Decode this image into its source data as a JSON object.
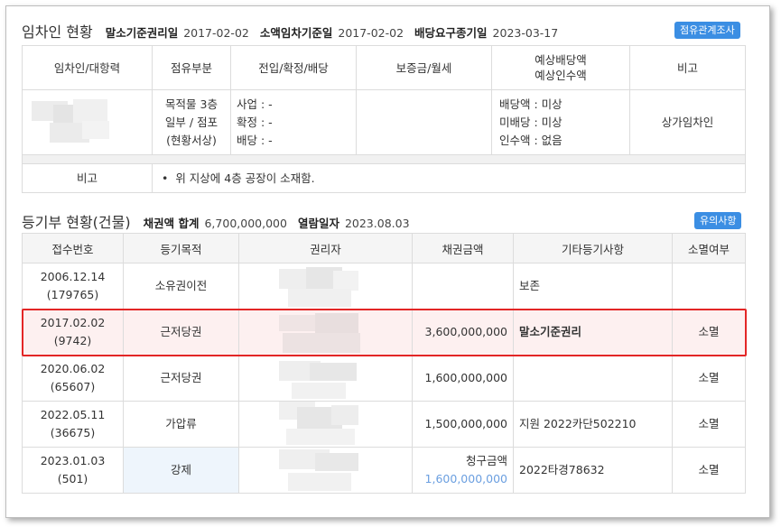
{
  "tenant": {
    "title": "임차인 현황",
    "meta": [
      {
        "label": "말소기준권리일",
        "value": "2017-02-02"
      },
      {
        "label": "소액임차기준일",
        "value": "2017-02-02"
      },
      {
        "label": "배당요구종기일",
        "value": "2023-03-17"
      }
    ],
    "survey_button": "점유관계조사",
    "headers": [
      "임차인/대항력",
      "점유부분",
      "전입/확정/배당",
      "보증금/월세",
      "예상배당액\n예상인수액",
      "비고"
    ],
    "row": {
      "occupancy": [
        "목적물 3층",
        "일부 / 점포",
        "(현황서상)"
      ],
      "dates": [
        "사업 : -",
        "확정 : -",
        "배당 : -"
      ],
      "deposit": "",
      "dividend": [
        "배당액 : 미상",
        "미배당 : 미상",
        "인수액 : 없음"
      ],
      "note": "상가임차인"
    },
    "remark_label": "비고",
    "remark_text": "위 지상에 4층 공장이 소재함."
  },
  "registry": {
    "title": "등기부 현황(건물)",
    "meta": [
      {
        "label": "채권액 합계",
        "value": "6,700,000,000"
      },
      {
        "label": "열람일자",
        "value": "2023.08.03"
      }
    ],
    "notice_button": "유의사항",
    "headers": [
      "접수번호",
      "등기목적",
      "권리자",
      "채권금액",
      "기타등기사항",
      "소멸여부"
    ],
    "rows": [
      {
        "date": "2006.12.14",
        "no": "(179765)",
        "purpose": "소유권이전",
        "amount": "",
        "amount_label": "",
        "etc": "보존",
        "extinct": ""
      },
      {
        "date": "2017.02.02",
        "no": "(9742)",
        "purpose": "근저당권",
        "amount": "3,600,000,000",
        "amount_label": "",
        "etc": "말소기준권리",
        "extinct": "소멸"
      },
      {
        "date": "2020.06.02",
        "no": "(65607)",
        "purpose": "근저당권",
        "amount": "1,600,000,000",
        "amount_label": "",
        "etc": "",
        "extinct": "소멸"
      },
      {
        "date": "2022.05.11",
        "no": "(36675)",
        "purpose": "가압류",
        "amount": "1,500,000,000",
        "amount_label": "",
        "etc": "지원 2022카단502210",
        "extinct": "소멸"
      },
      {
        "date": "2023.01.03",
        "no": "(501)",
        "purpose": "강제",
        "amount": "1,600,000,000",
        "amount_label": "청구금액",
        "etc": "2022타경78632",
        "extinct": "소멸"
      }
    ]
  },
  "colors": {
    "button": "#3b8ee3",
    "highlight_border": "#e32626",
    "highlight_fill": "#fdf0f0",
    "blue_amount": "#6b9fe0"
  }
}
